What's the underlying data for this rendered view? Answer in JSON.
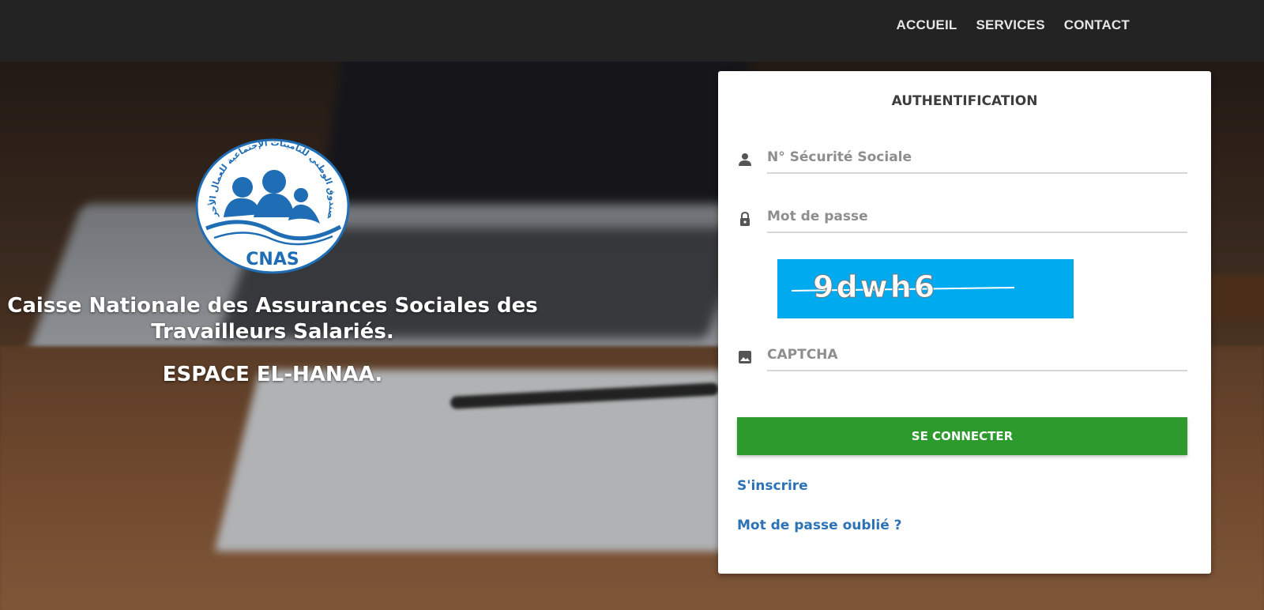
{
  "nav": {
    "items": [
      {
        "label": "ACCUEIL"
      },
      {
        "label": "SERVICES"
      },
      {
        "label": "CONTACT"
      }
    ]
  },
  "brand": {
    "logo_text": "CNAS",
    "logo_arabic": "الصندوق الوطني للتأمينات الإجتماعية للعمال الأجراء",
    "org_line1": "Caisse Nationale des Assurances Sociales des",
    "org_line2": "Travailleurs Salariés.",
    "space_name": "ESPACE EL-HANAA."
  },
  "login": {
    "title": "AUTHENTIFICATION",
    "ssn_placeholder": "N° Sécurité Sociale",
    "password_placeholder": "Mot de passe",
    "captcha_text": "9dwh6",
    "captcha_placeholder": "CAPTCHA",
    "submit_label": "SE CONNECTER",
    "register_link": "S'inscrire",
    "forgot_link": "Mot de passe oublié ?"
  },
  "colors": {
    "navbar": "#232323",
    "button_green": "#2d9a2d",
    "link_blue": "#2c72b6",
    "captcha_bg": "#00aaef",
    "logo_blue": "#1f6db5"
  },
  "icons": {
    "user": "person-icon",
    "password": "lock-icon",
    "captcha": "image-icon"
  }
}
